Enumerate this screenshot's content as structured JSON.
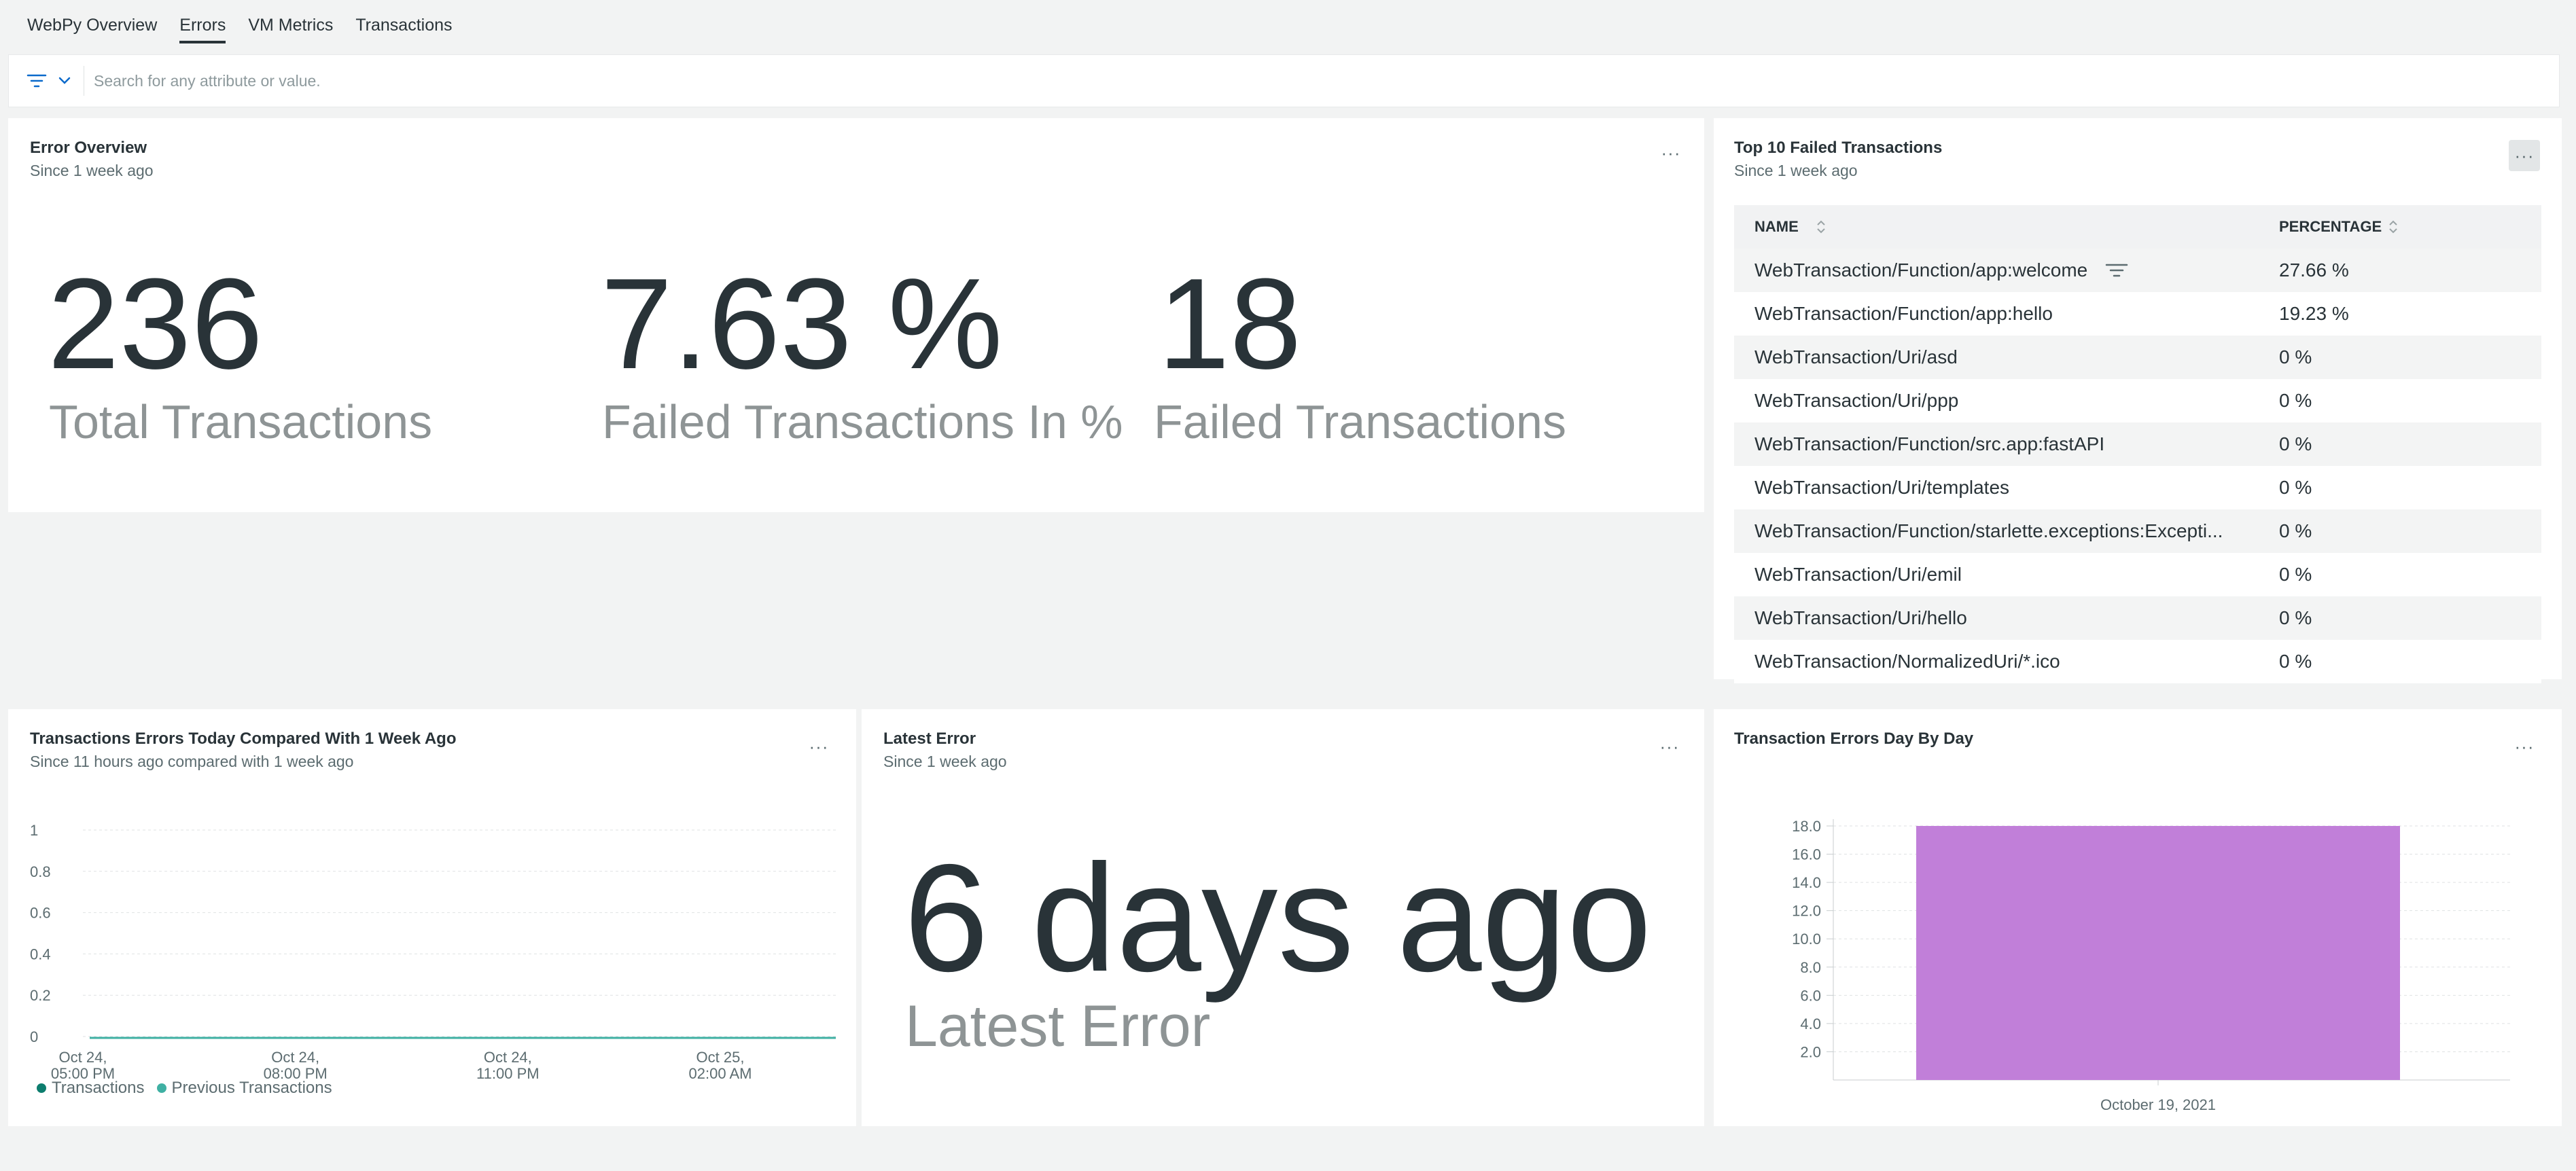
{
  "tabs": [
    {
      "label": "WebPy Overview",
      "active": false
    },
    {
      "label": "Errors",
      "active": true
    },
    {
      "label": "VM Metrics",
      "active": false
    },
    {
      "label": "Transactions",
      "active": false
    }
  ],
  "filter": {
    "placeholder": "Search for any attribute or value."
  },
  "error_overview": {
    "title": "Error Overview",
    "subtitle": "Since 1 week ago",
    "metrics": [
      {
        "value": "236",
        "label": "Total Transactions"
      },
      {
        "value": "7.63 %",
        "label": "Failed Transactions In %"
      },
      {
        "value": "18",
        "label": "Failed Transactions"
      }
    ]
  },
  "top_failed": {
    "title": "Top 10 Failed Transactions",
    "subtitle": "Since 1 week ago",
    "columns": [
      "NAME",
      "PERCENTAGE"
    ],
    "rows": [
      {
        "name": "WebTransaction/Function/app:welcome",
        "pct": "27.66 %"
      },
      {
        "name": "WebTransaction/Function/app:hello",
        "pct": "19.23 %"
      },
      {
        "name": "WebTransaction/Uri/asd",
        "pct": "0 %"
      },
      {
        "name": "WebTransaction/Uri/ppp",
        "pct": "0 %"
      },
      {
        "name": "WebTransaction/Function/src.app:fastAPI",
        "pct": "0 %"
      },
      {
        "name": "WebTransaction/Uri/templates",
        "pct": "0 %"
      },
      {
        "name": "WebTransaction/Function/starlette.exceptions:Excepti...",
        "pct": "0 %"
      },
      {
        "name": "WebTransaction/Uri/emil",
        "pct": "0 %"
      },
      {
        "name": "WebTransaction/Uri/hello",
        "pct": "0 %"
      },
      {
        "name": "WebTransaction/NormalizedUri/*.ico",
        "pct": "0 %"
      }
    ]
  },
  "compare": {
    "title": "Transactions Errors Today Compared With 1 Week Ago",
    "subtitle": "Since 11 hours ago compared with 1 week ago"
  },
  "latest_error": {
    "title": "Latest Error",
    "subtitle": "Since 1 week ago",
    "value": "6 days ago",
    "label": "Latest Error"
  },
  "day_by_day": {
    "title": "Transaction Errors Day By Day"
  },
  "colors": {
    "transactions": "#0d7d6e",
    "previous": "#3fb0a3",
    "bar": "#c17fd9"
  },
  "chart_data": [
    {
      "type": "line",
      "x_ticks": [
        [
          "Oct 24,",
          "05:00 PM"
        ],
        [
          "Oct 24,",
          "08:00 PM"
        ],
        [
          "Oct 24,",
          "11:00 PM"
        ],
        [
          "Oct 25,",
          "02:00 AM"
        ]
      ],
      "y_ticks": [
        "1",
        "0.8",
        "0.6",
        "0.4",
        "0.2",
        "0"
      ],
      "ylim": [
        0,
        1
      ],
      "grid": true,
      "legend_position": "bottom-left",
      "series": [
        {
          "name": "Transactions",
          "values": [
            0,
            0,
            0,
            0,
            0
          ]
        },
        {
          "name": "Previous Transactions",
          "values": [
            0,
            0,
            0,
            0,
            0
          ]
        }
      ]
    },
    {
      "type": "bar",
      "categories": [
        "October 19, 2021"
      ],
      "values": [
        18
      ],
      "y_ticks": [
        "18.0",
        "16.0",
        "14.0",
        "12.0",
        "10.0",
        "8.0",
        "6.0",
        "4.0",
        "2.0"
      ],
      "ylim": [
        0,
        18
      ],
      "grid": true
    }
  ]
}
